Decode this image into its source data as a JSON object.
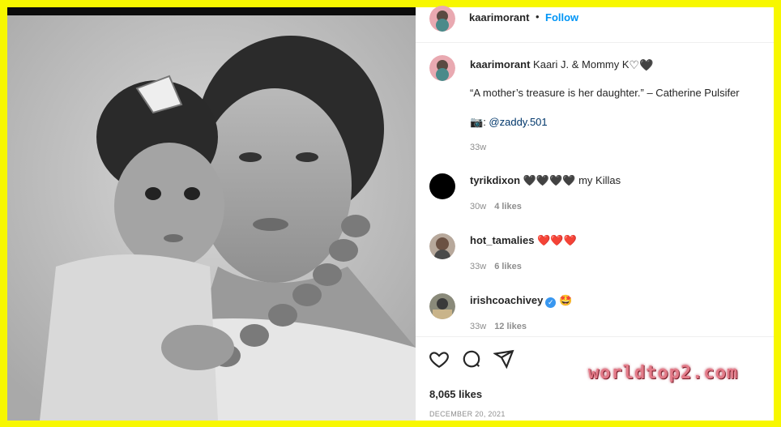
{
  "post": {
    "username": "kaarimorant",
    "follow_separator": "•",
    "follow_label": "Follow"
  },
  "caption": {
    "username": "kaarimorant",
    "text": "Kaari J. & Mommy K",
    "hearts": "♡🖤",
    "quote": "“A mother’s treasure is her daughter.” – Catherine Pulsifer",
    "camera_emoji": "📷",
    "credit_prefix": ": ",
    "credit_handle": "@zaddy.501",
    "age": "33w"
  },
  "comments": [
    {
      "username": "tyrikdixon",
      "text": "🖤🖤🖤🖤 my Killas",
      "age": "30w",
      "likes": "4 likes"
    },
    {
      "username": "hot_tamalies",
      "text": "❤️❤️❤️",
      "age": "33w",
      "likes": "6 likes"
    },
    {
      "username": "irishcoachivey",
      "verified_mark": "✓",
      "text": "🤩",
      "age": "33w",
      "likes": "12 likes"
    }
  ],
  "stats": {
    "likes": "8,065 likes",
    "date": "DECEMBER 20, 2021"
  },
  "watermark": "worldtop2.com",
  "colors": {
    "frame": "#f7f700",
    "accent": "#0095f6",
    "muted": "#8e8e8e",
    "heart_red": "#ed4956"
  }
}
